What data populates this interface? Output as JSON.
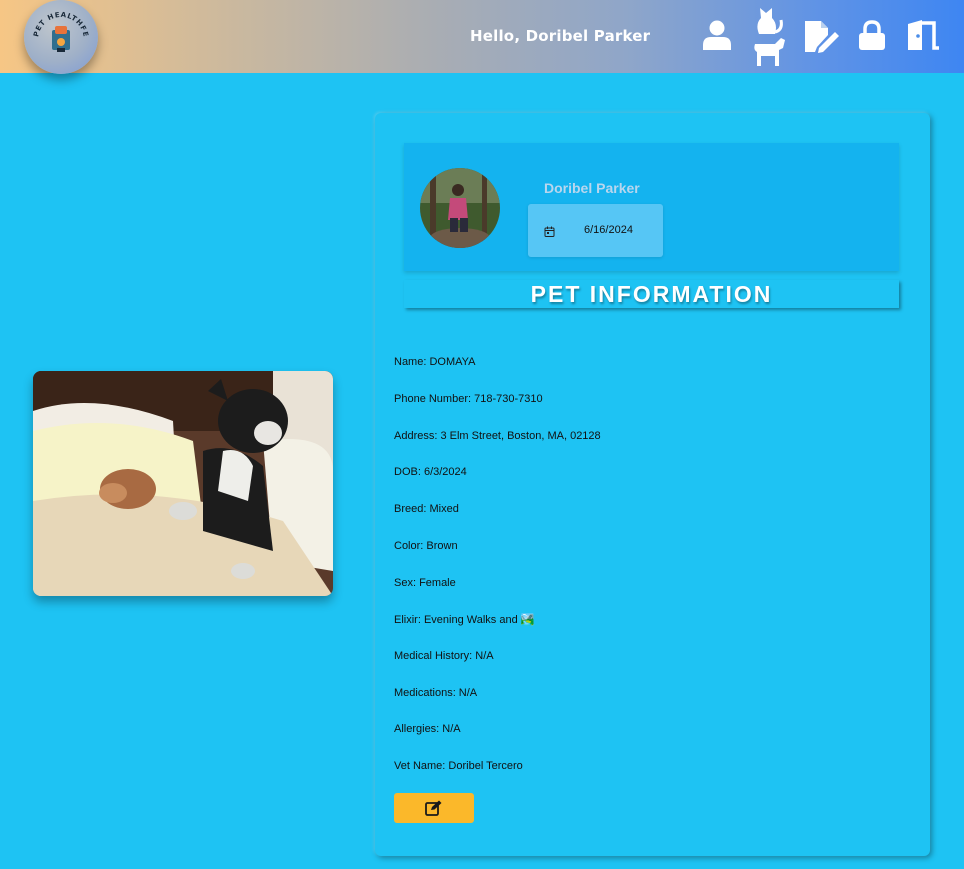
{
  "header": {
    "logo_text": "PET HEALTHFETCH",
    "greeting": "Hello, Doribel Parker",
    "nav_icons": [
      "user-icon",
      "pets-icon",
      "edit-document-icon",
      "lock-icon",
      "logout-door-icon"
    ]
  },
  "profile": {
    "owner_name": "Doribel Parker",
    "date": "6/16/2024",
    "calendar_icon": "calendar-icon"
  },
  "section_title": "PET INFORMATION",
  "pet_fields": [
    "Name: DOMAYA",
    "Phone Number: 718-730-7310",
    "Address: 3 Elm Street, Boston, MA, 02128",
    "DOB: 6/3/2024",
    "Breed: Mixed",
    "Color: Brown",
    "Sex: Female",
    "Elixir: Evening Walks and 🏞️",
    "Medical History: N/A",
    "Medications: N/A",
    "Allergies: N/A",
    "Vet Name: Doribel Tercero"
  ],
  "edit_button_icon": "edit-icon",
  "colors": {
    "background": "#1ec3f3",
    "profile_box": "#14b3ef",
    "date_box": "#56c6f5",
    "edit_button": "#fbb82a"
  }
}
